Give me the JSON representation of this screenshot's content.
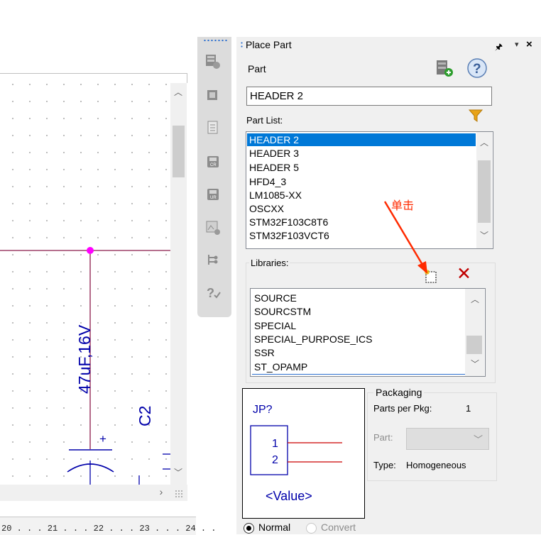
{
  "panel": {
    "title": "Place Part",
    "pin_icon": "pin-icon",
    "dropdown_icon": "chevron-down-icon",
    "close_icon": "close-icon",
    "part_label": "Part",
    "part_value": "HEADER 2",
    "part_list_label": "Part List:",
    "part_list": [
      "HEADER 2",
      "HEADER 3",
      "HEADER 5",
      "HFD4_3",
      "LM1085-XX",
      "OSCXX",
      "STM32F103C8T6",
      "STM32F103VCT6"
    ],
    "libraries_label": "Libraries:",
    "libraries": [
      "SOURCE",
      "SOURCSTM",
      "SPECIAL",
      "SPECIAL_PURPOSE_ICS",
      "SSR",
      "ST_OPAMP"
    ],
    "packaging": {
      "title": "Packaging",
      "parts_per_pkg_label": "Parts per Pkg:",
      "parts_per_pkg_value": "1",
      "part_label": "Part:",
      "type_label": "Type:",
      "type_value": "Homogeneous"
    },
    "preview": {
      "refdes": "JP?",
      "pin1": "1",
      "pin2": "2",
      "value": "<Value>"
    },
    "view_modes": {
      "normal": "Normal",
      "convert": "Convert",
      "selected": "Normal"
    }
  },
  "annotation": {
    "text": "单击"
  },
  "schematic": {
    "capacitor_value": "47uF,16V",
    "capacitor_ref": "C2",
    "plus_sign": "+",
    "ruler": "20 . . . 21 . . . 22 . . . 23 . . . 24 . ."
  },
  "colors": {
    "selection": "#0078d7",
    "wire": "#8b1a4a",
    "junction": "#ff00ff",
    "component_blue": "#0000aa",
    "pin_red": "#cc0000",
    "annotation_red": "#ff2a00",
    "delete_red": "#c00000",
    "filter_orange": "#e8a317"
  }
}
